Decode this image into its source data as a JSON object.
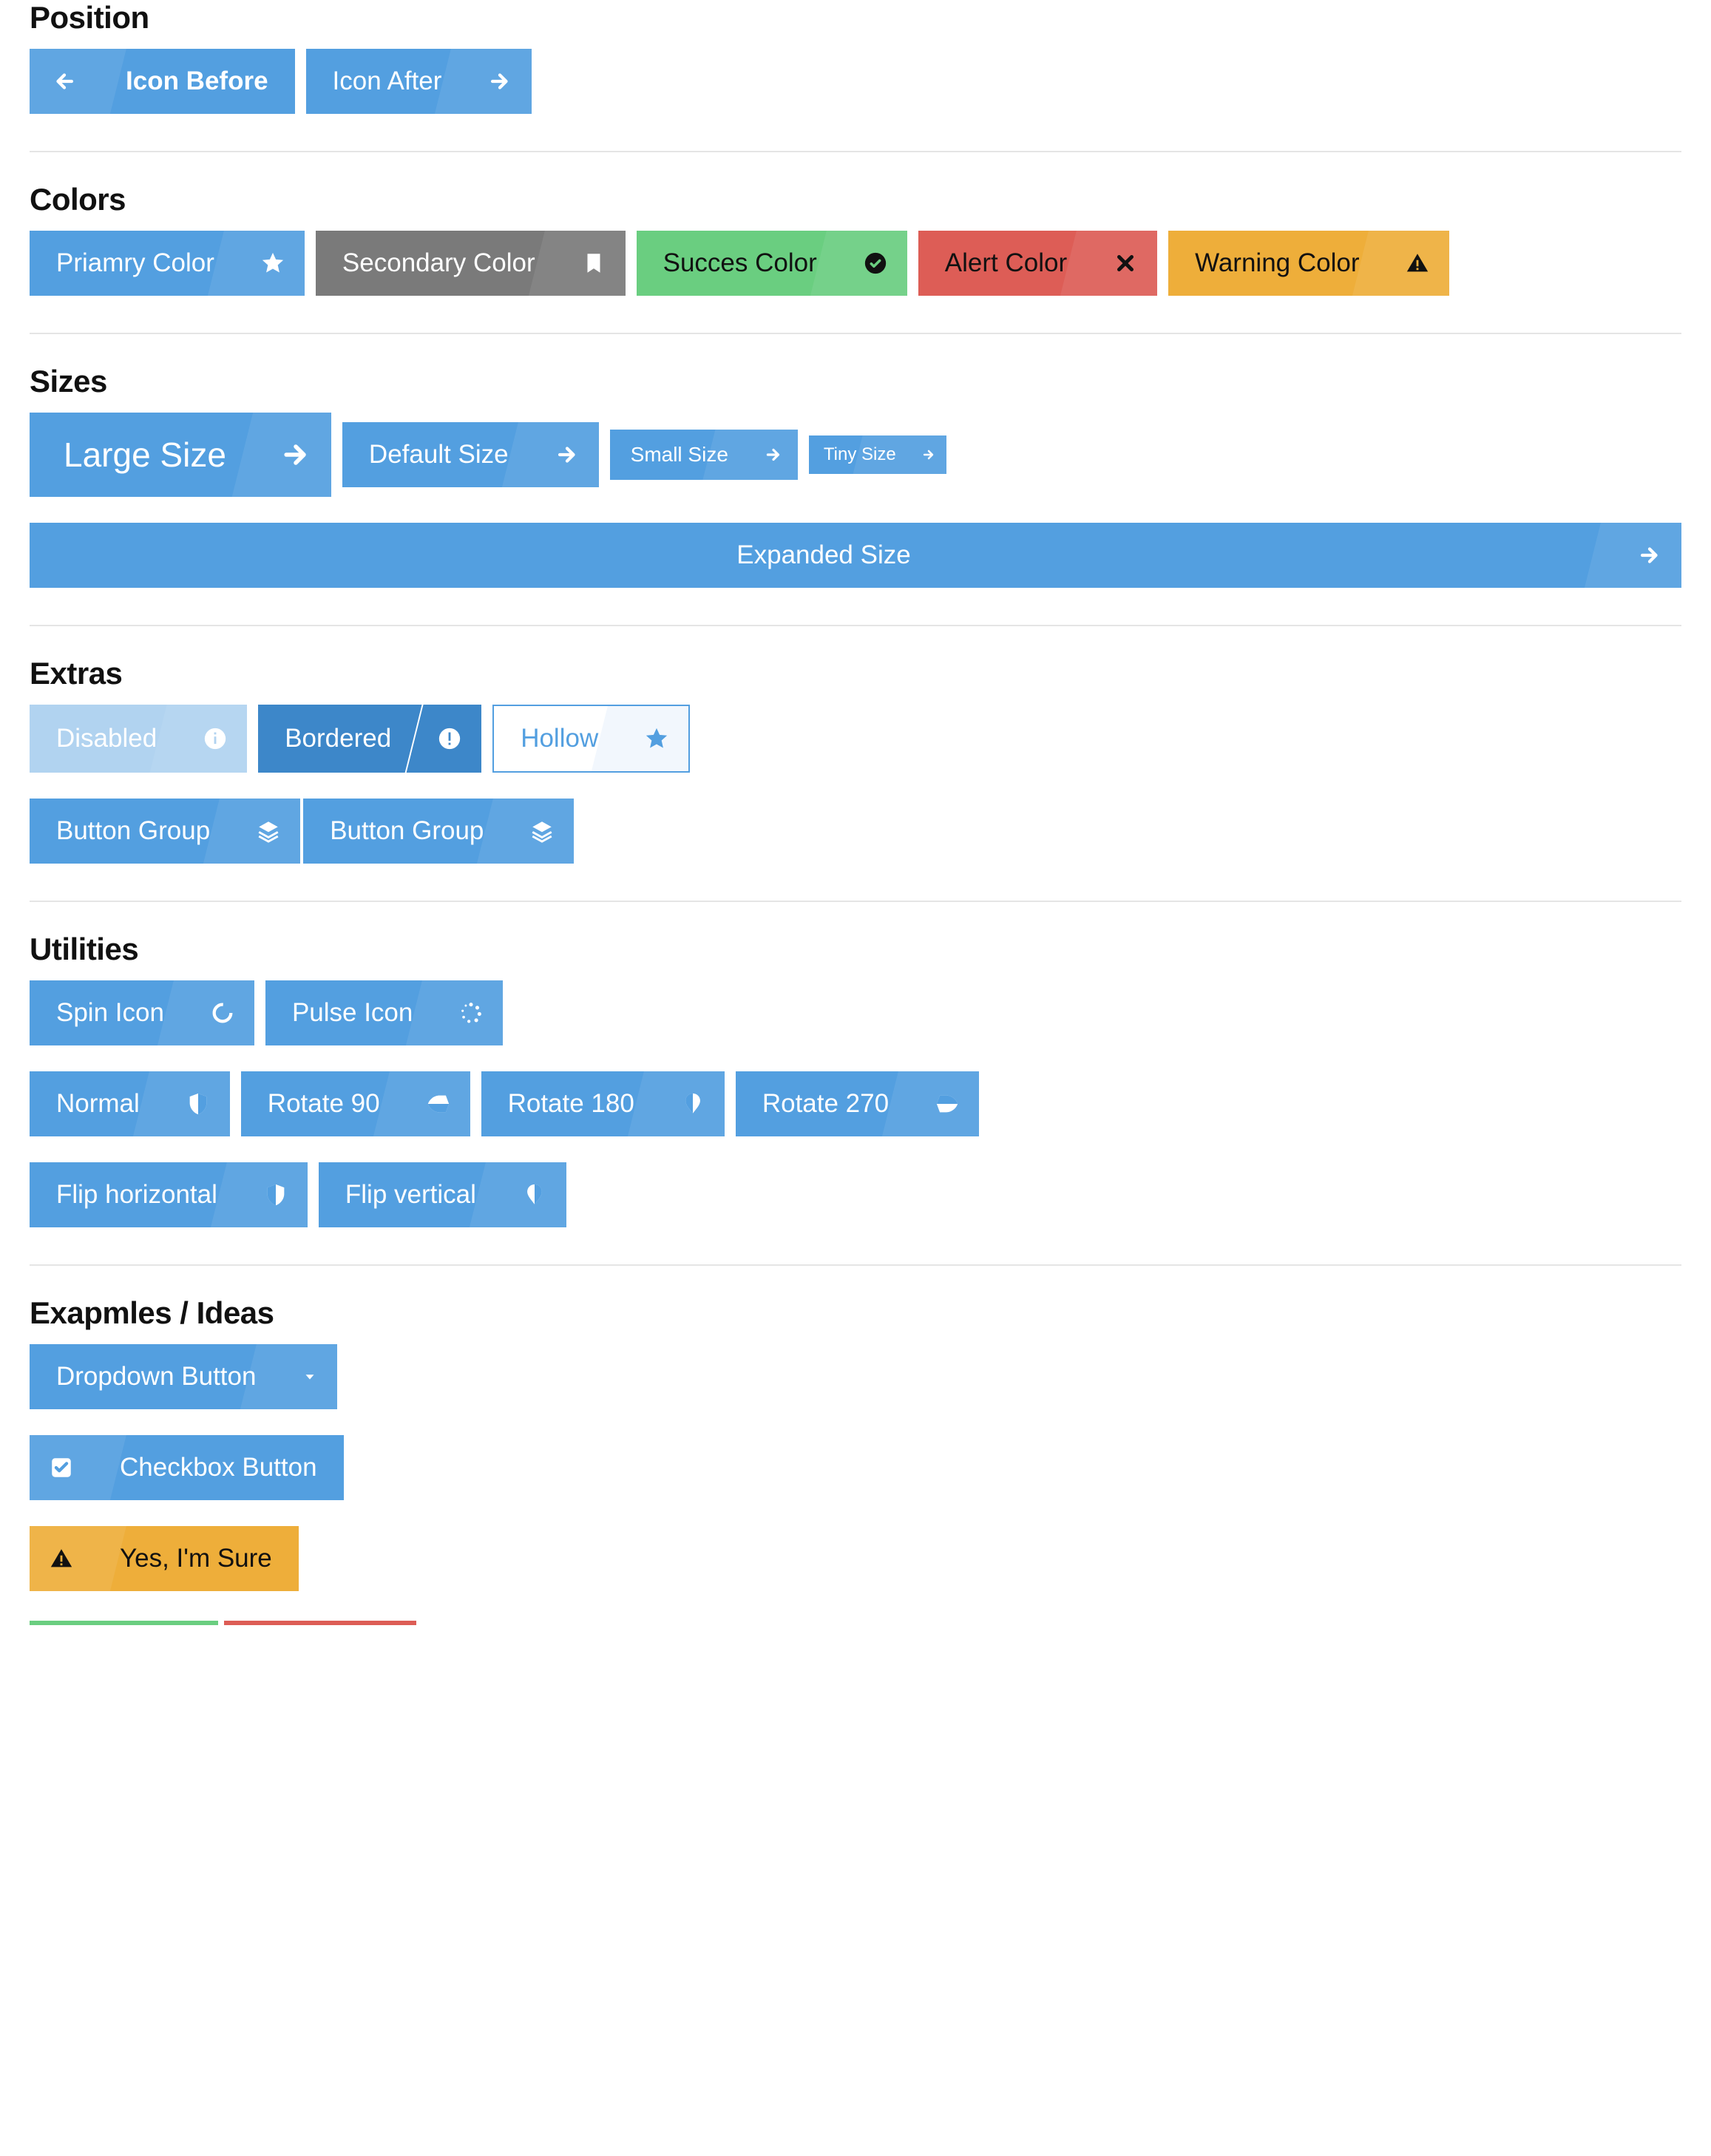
{
  "position": {
    "heading": "Position",
    "icon_before": "Icon Before",
    "icon_after": "Icon After"
  },
  "colors": {
    "heading": "Colors",
    "primary": "Priamry Color",
    "secondary": "Secondary Color",
    "success": "Succes Color",
    "alert": "Alert Color",
    "warning": "Warning Color",
    "palette": {
      "primary": "#539fe0",
      "secondary": "#7a7a7a",
      "success": "#6ace80",
      "alert": "#dd5d56",
      "warning": "#eeae3a"
    }
  },
  "sizes": {
    "heading": "Sizes",
    "large": "Large Size",
    "default": "Default Size",
    "small": "Small Size",
    "tiny": "Tiny Size",
    "expanded": "Expanded Size"
  },
  "extras": {
    "heading": "Extras",
    "disabled": "Disabled",
    "bordered": "Bordered",
    "hollow": "Hollow",
    "button_group": "Button Group"
  },
  "utilities": {
    "heading": "Utilities",
    "spin": "Spin Icon",
    "pulse": "Pulse Icon",
    "normal": "Normal",
    "rotate90": "Rotate 90",
    "rotate180": "Rotate 180",
    "rotate270": "Rotate 270",
    "flip_h": "Flip horizontal",
    "flip_v": "Flip vertical"
  },
  "examples": {
    "heading": "Exapmles / Ideas",
    "dropdown": "Dropdown Button",
    "checkbox": "Checkbox Button",
    "confirm": "Yes, I'm Sure"
  }
}
